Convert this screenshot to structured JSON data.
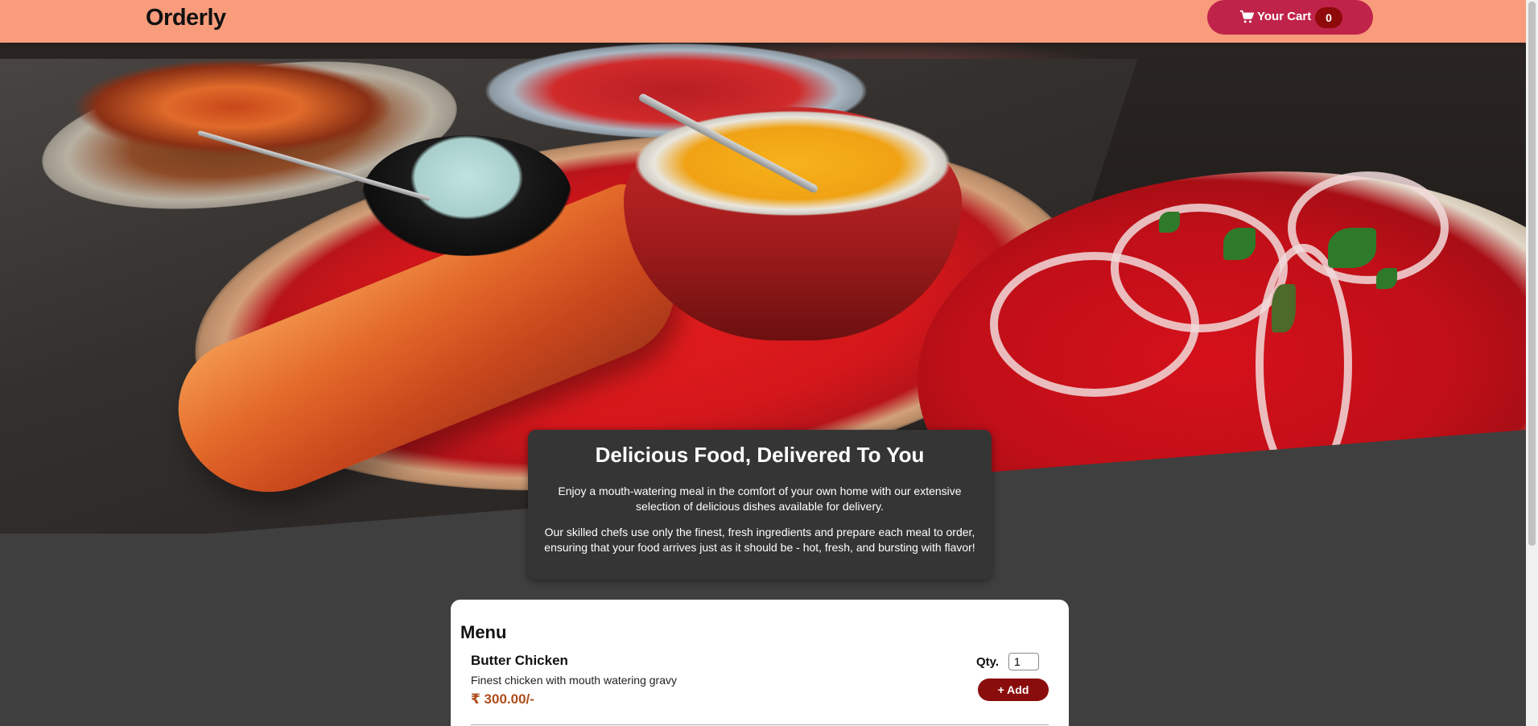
{
  "header": {
    "brand": "Orderly",
    "cart": {
      "label": "Your Cart",
      "count": "0",
      "icon": "cart-icon"
    }
  },
  "hero": {
    "image_alt": "table full of delicious food"
  },
  "intro": {
    "title": "Delicious Food, Delivered To You",
    "paragraph1": "Enjoy a mouth-watering meal in the comfort of your own home with our extensive selection of delicious dishes available for delivery.",
    "paragraph2": "Our skilled chefs use only the finest, fresh ingredients and prepare each meal to order, ensuring that your food arrives just as it should be - hot, fresh, and bursting with flavor!"
  },
  "menu": {
    "title": "Menu",
    "items": [
      {
        "name": "Butter Chicken",
        "description": "Finest chicken with mouth watering gravy",
        "price": "₹ 300.00/-",
        "qty_label": "Qty.",
        "qty_value": "1",
        "add_label": "+ Add"
      }
    ]
  },
  "colors": {
    "header_bg": "#f89c7c",
    "cart_button": "#c0234a",
    "cart_badge": "#8f0a0a",
    "page_bg": "#3f3f3f",
    "intro_bg": "#353535",
    "price": "#ad4c1a",
    "add_button": "#8a0d0d"
  }
}
